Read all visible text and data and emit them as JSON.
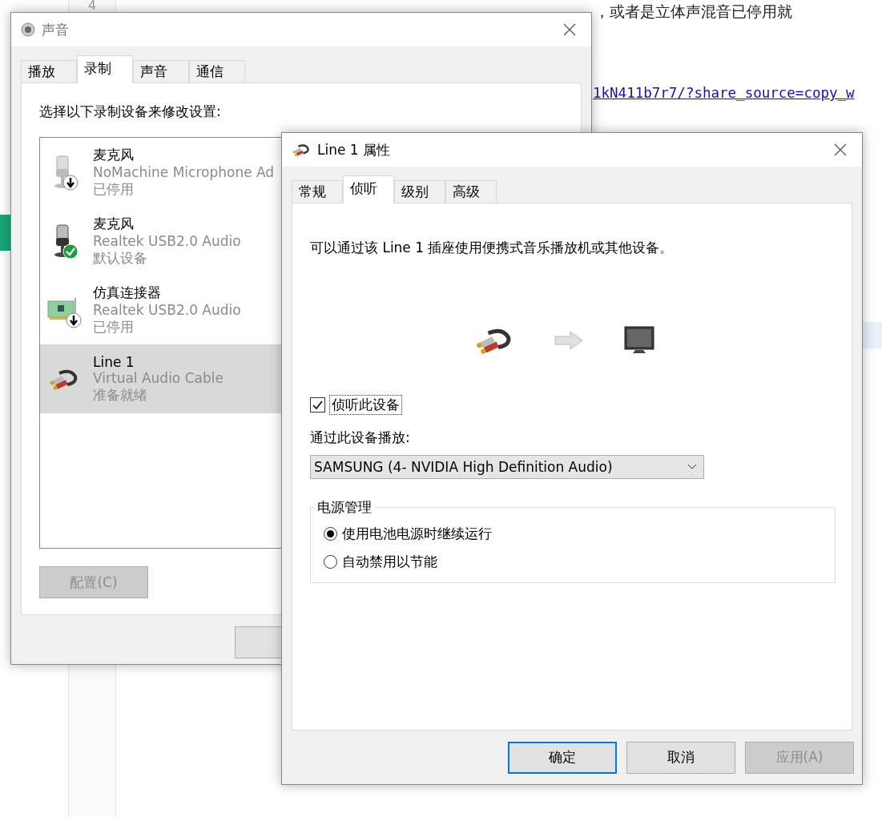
{
  "background_page": {
    "line_number": "4",
    "heading_text": "，或者是立体声混音已停用就",
    "link": "1kN411b7r7/?share_source=copy_w"
  },
  "sound_dialog": {
    "title": "声音",
    "tabs": [
      {
        "label": "播放",
        "selected": false
      },
      {
        "label": "录制",
        "selected": true
      },
      {
        "label": "声音",
        "selected": false
      },
      {
        "label": "通信",
        "selected": false
      }
    ],
    "instruction": "选择以下录制设备来修改设置:",
    "devices": [
      {
        "name": "麦克风",
        "description": "NoMachine Microphone Ad",
        "status": "已停用",
        "kind": "mic",
        "disabled": true,
        "default": false,
        "selected": false
      },
      {
        "name": "麦克风",
        "description": "Realtek USB2.0 Audio",
        "status": "默认设备",
        "kind": "mic",
        "disabled": false,
        "default": true,
        "selected": false
      },
      {
        "name": "仿真连接器",
        "description": "Realtek USB2.0 Audio",
        "status": "已停用",
        "kind": "card",
        "disabled": true,
        "default": false,
        "selected": false
      },
      {
        "name": "Line 1",
        "description": "Virtual Audio Cable",
        "status": "准备就绪",
        "kind": "cable",
        "disabled": false,
        "default": false,
        "selected": true
      }
    ],
    "configure_button": {
      "label": "配置(C)",
      "disabled": true
    }
  },
  "properties_dialog": {
    "title": "Line 1 属性",
    "tabs": [
      {
        "label": "常规",
        "selected": false
      },
      {
        "label": "侦听",
        "selected": true
      },
      {
        "label": "级别",
        "selected": false
      },
      {
        "label": "高级",
        "selected": false
      }
    ],
    "description": "可以通过该 Line 1 插座使用便携式音乐播放机或其他设备。",
    "listen_checkbox": {
      "label": "侦听此设备",
      "checked": true
    },
    "playback_label": "通过此设备播放:",
    "playback_device": "SAMSUNG (4- NVIDIA High Definition Audio)",
    "power_group": {
      "title": "电源管理",
      "options": [
        {
          "label": "使用电池电源时继续运行",
          "selected": true
        },
        {
          "label": "自动禁用以节能",
          "selected": false
        }
      ]
    },
    "buttons": [
      {
        "label": "确定",
        "default": true,
        "disabled": false
      },
      {
        "label": "取消",
        "default": false,
        "disabled": false
      },
      {
        "label": "应用(A)",
        "default": false,
        "disabled": true
      }
    ]
  }
}
